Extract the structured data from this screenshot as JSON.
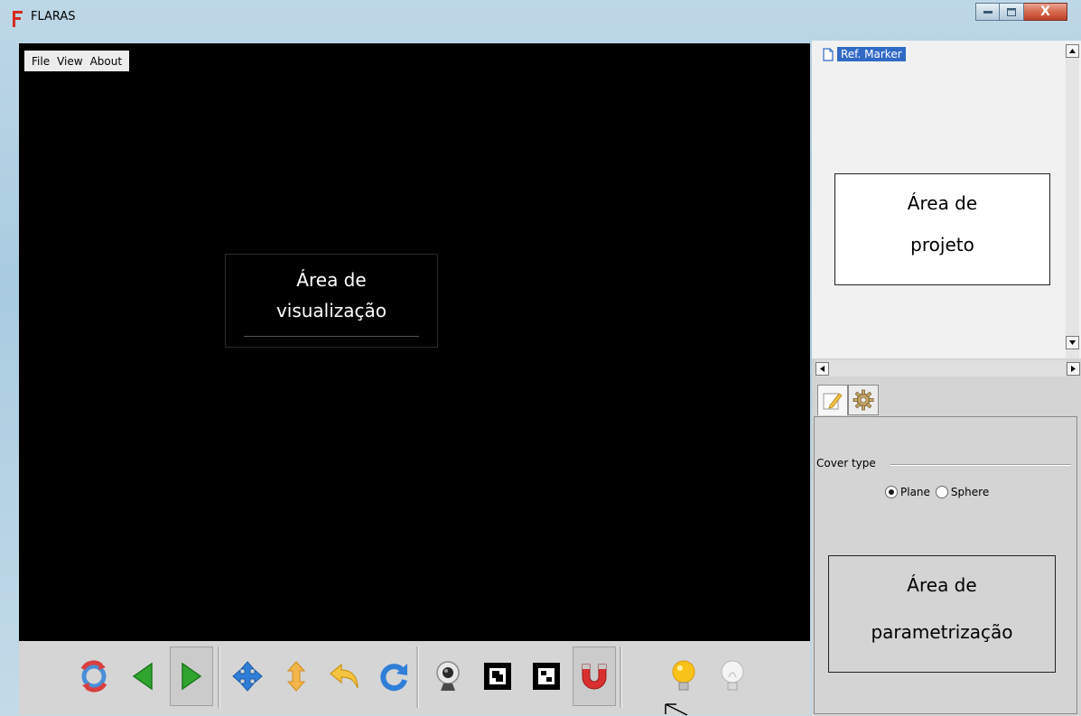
{
  "window": {
    "title": "FLARAS",
    "close_glyph": "X"
  },
  "menu": {
    "file": "File",
    "view": "View",
    "about": "About"
  },
  "viewport": {
    "label_line1": "Área de",
    "label_line2": "visualização"
  },
  "project_tree": {
    "items": [
      {
        "label": "Ref. Marker",
        "selected": true
      }
    ],
    "annotation_line1": "Área de",
    "annotation_line2": "projeto"
  },
  "parameters": {
    "tabs": [
      "edit-icon",
      "gear-icon"
    ],
    "group_label": "Cover type",
    "options": [
      {
        "label": "Plane",
        "checked": true
      },
      {
        "label": "Sphere",
        "checked": false
      }
    ],
    "annotation_line1": "Área de",
    "annotation_line2": "parametrização"
  },
  "toolbar": {
    "buttons": [
      "reset-icon",
      "previous-icon",
      "next-icon",
      "move-icon",
      "vertical-move-icon",
      "undo-icon",
      "redo-icon",
      "webcam-icon",
      "marker-icon",
      "marker2-icon",
      "magnet-icon",
      "light-on-icon",
      "light-off-icon"
    ],
    "pressed": [
      "next-icon",
      "magnet-icon"
    ]
  },
  "colors": {
    "selection": "#316ac5",
    "viewport_bg": "#000000",
    "panel_bg": "#d4d4d4"
  }
}
